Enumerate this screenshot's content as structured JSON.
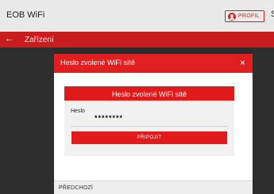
{
  "app": {
    "title": "EOB WiFi",
    "edge_glyph": "S"
  },
  "profile": {
    "label": "PROFIL",
    "icon": "person-icon"
  },
  "subbar": {
    "back_icon": "←",
    "title": "Zařízení"
  },
  "dialog": {
    "title": "Heslo zvolené WiFi sítě",
    "close_icon": "×",
    "card_title": "Heslo zvolené WiFi sítě",
    "field_label": "Heslo",
    "field_value": "********",
    "connect_label": "PŘIPOJIT",
    "prev_label": "PŘEDCHOZÍ"
  },
  "colors": {
    "accent": "#e11b1b",
    "subbar": "#c91c1c",
    "topbar": "#e9e9e9",
    "backdrop": "#2e2e2e"
  }
}
